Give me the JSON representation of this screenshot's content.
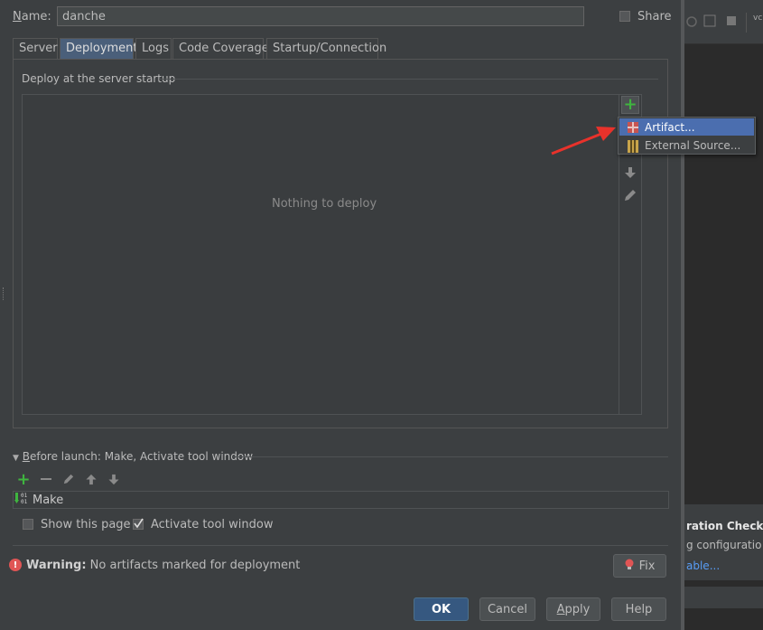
{
  "name_field": {
    "label": "Name:",
    "value": "danche"
  },
  "share": {
    "label": "Share",
    "checked": false
  },
  "tabs": [
    {
      "label": "Server",
      "selected": false
    },
    {
      "label": "Deployment",
      "selected": true
    },
    {
      "label": "Logs",
      "selected": false
    },
    {
      "label": "Code Coverage",
      "selected": false
    },
    {
      "label": "Startup/Connection",
      "selected": false
    }
  ],
  "deployment": {
    "section_title": "Deploy at the server startup",
    "empty_text": "Nothing to deploy"
  },
  "add_menu": {
    "items": [
      {
        "label": "Artifact...",
        "icon": "artifact-icon",
        "highlighted": true
      },
      {
        "label": "External Source...",
        "icon": "external-source-icon",
        "highlighted": false
      }
    ]
  },
  "before_launch": {
    "title": "Before launch: Make, Activate tool window",
    "tasks": [
      {
        "label": "Make",
        "icon": "make-icon"
      }
    ]
  },
  "show_page": {
    "label": "Show this page",
    "checked": false
  },
  "activate_tool_window": {
    "label": "Activate tool window",
    "checked": true
  },
  "warning": {
    "prefix": "Warning:",
    "message": "No artifacts marked for deployment",
    "fix_label": "Fix"
  },
  "buttons": {
    "ok": "OK",
    "cancel": "Cancel",
    "apply": "Apply",
    "help": "Help"
  },
  "background_notification": {
    "title": "ration Check",
    "text": "g configuratio",
    "link": "able..."
  },
  "colors": {
    "background": "#3c3f41",
    "selection": "#4b6eaf",
    "ok_button": "#365880",
    "add_green": "#3fb53f",
    "warning_red": "#e05555",
    "arrow_red": "#e8322b"
  }
}
